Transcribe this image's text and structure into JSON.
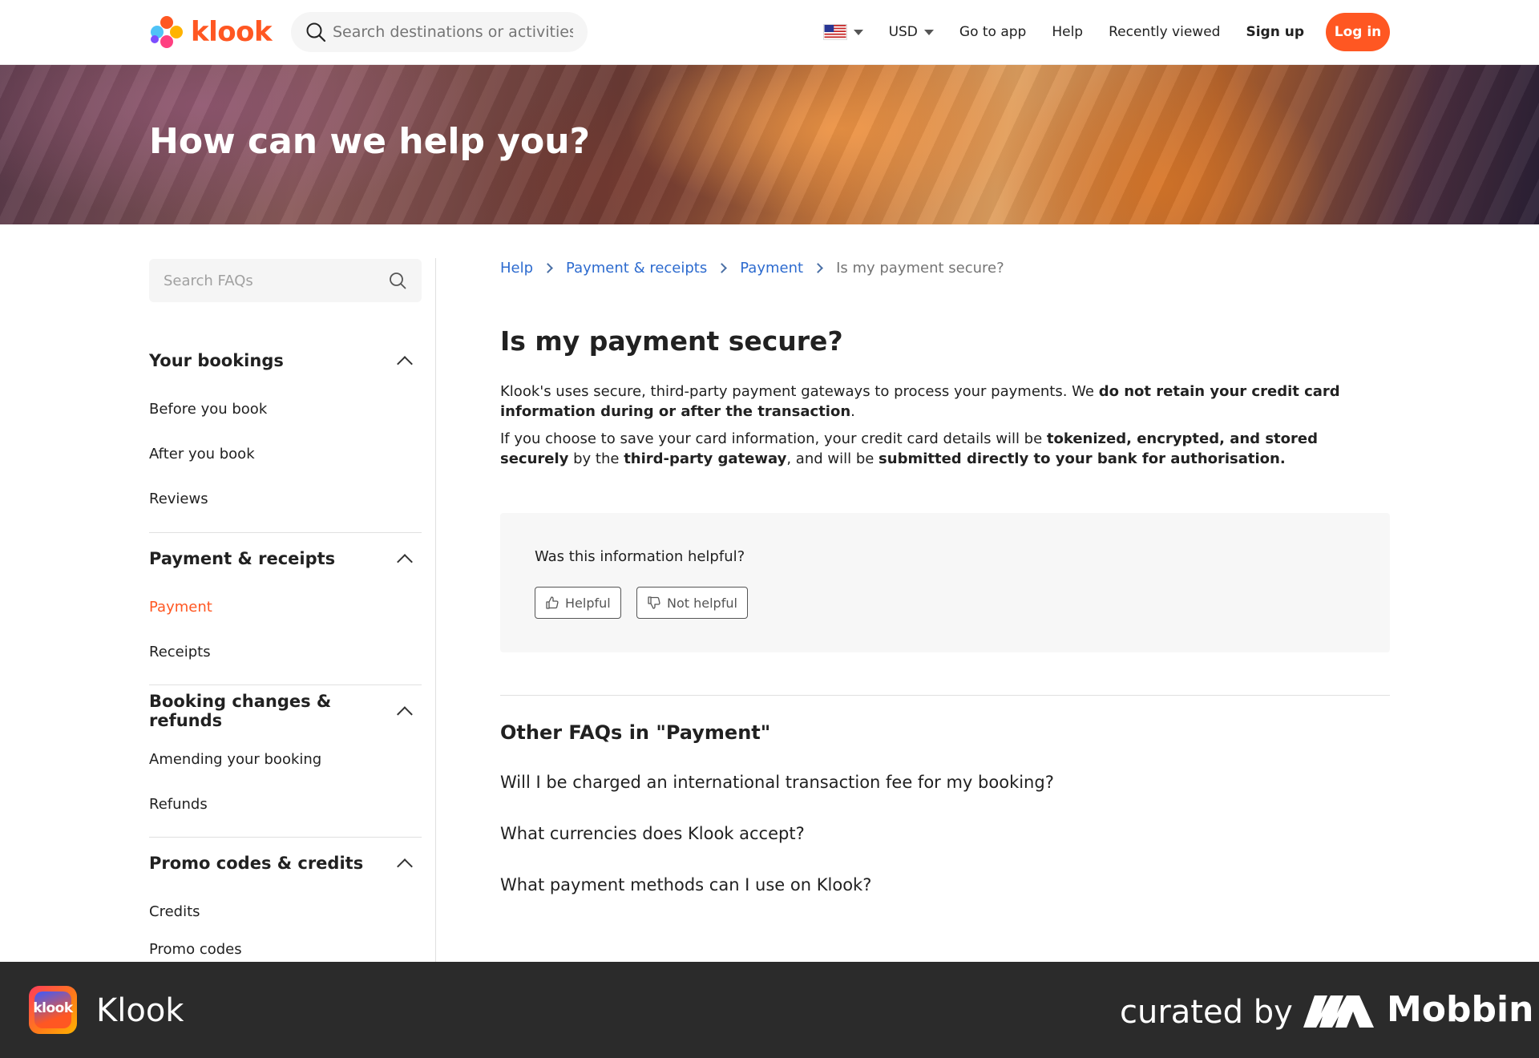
{
  "header": {
    "logo_text": "klook",
    "search_placeholder": "Search destinations or activities",
    "currency": "USD",
    "nav": {
      "go_to_app": "Go to app",
      "help": "Help",
      "recently_viewed": "Recently viewed",
      "sign_up": "Sign up",
      "log_in": "Log in"
    }
  },
  "hero": {
    "title": "How can we help you?"
  },
  "sidebar": {
    "search_placeholder": "Search FAQs",
    "sections": [
      {
        "title": "Your bookings",
        "items": [
          "Before you book",
          "After you book",
          "Reviews"
        ]
      },
      {
        "title": "Payment & receipts",
        "items": [
          "Payment",
          "Receipts"
        ]
      },
      {
        "title": "Booking changes & refunds",
        "items": [
          "Amending your booking",
          "Refunds"
        ]
      },
      {
        "title": "Promo codes & credits",
        "items": [
          "Credits",
          "Promo codes"
        ]
      }
    ]
  },
  "breadcrumb": [
    "Help",
    "Payment & receipts",
    "Payment",
    "Is my payment secure?"
  ],
  "article": {
    "title": "Is my payment secure?",
    "p1_a": "Klook's uses secure, third-party payment gateways to process your payments. We ",
    "p1_b": "do not retain your credit card information during or after the transaction",
    "p1_c": ".",
    "p2_a": "If you choose to save your card information, your credit card details will be ",
    "p2_b": "tokenized, encrypted, and stored securely",
    "p2_c": " by the ",
    "p2_d": "third-party gateway",
    "p2_e": ", and will be ",
    "p2_f": "submitted directly to your bank for authorisation."
  },
  "feedback": {
    "question": "Was this information helpful?",
    "helpful": "Helpful",
    "not_helpful": "Not helpful"
  },
  "other_faqs": {
    "title": "Other FAQs in \"Payment\"",
    "items": [
      "Will I be charged an international transaction fee for my booking?",
      "What currencies does Klook accept?",
      "What payment methods can I use on Klook?"
    ]
  },
  "footer": {
    "app_icon_text": "klook",
    "app_name": "Klook",
    "curated_by": "curated by",
    "brand": "Mobbin"
  },
  "colors": {
    "accent": "#ff5722",
    "link": "#2d6bcf",
    "footer_bg": "#2b2b2b"
  }
}
